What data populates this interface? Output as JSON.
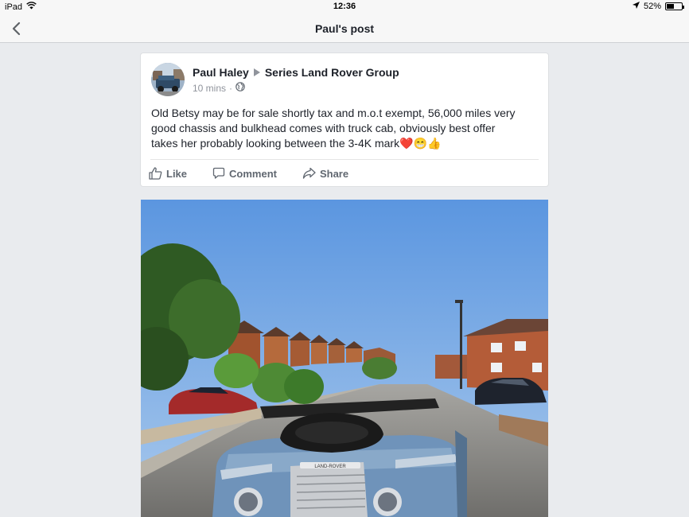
{
  "status": {
    "device": "iPad",
    "time": "12:36",
    "battery": "52%",
    "battery_level": 0.52
  },
  "nav": {
    "title": "Paul's post"
  },
  "post": {
    "author": "Paul Haley",
    "group": "Series Land Rover Group",
    "time_ago": "10 mins",
    "separator": "·",
    "text_line1": "Old Betsy may be for sale shortly tax and m.o.t exempt, 56,000 miles very",
    "text_line2": "good chassis and bulkhead comes with truck cab, obviously best offer",
    "text_line3": "takes her probably looking between the 3-4K mark",
    "emojis": "❤️😁👍"
  },
  "actions": {
    "like": "Like",
    "comment": "Comment",
    "share": "Share"
  },
  "photo": {
    "grille_badge": "LAND-ROVER"
  },
  "colors": {
    "accent": "#4267b2",
    "action_gray": "#606770",
    "meta_gray": "#90949c",
    "sky": "#6fa6e6"
  }
}
